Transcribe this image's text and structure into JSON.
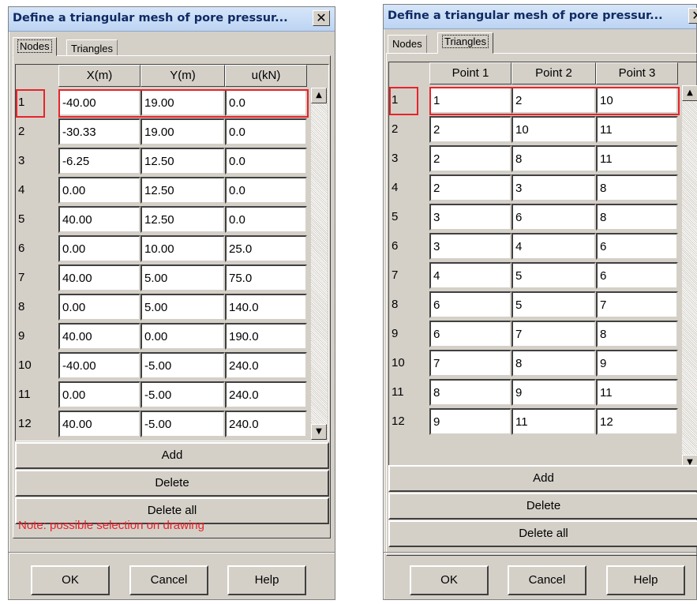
{
  "left_dialog": {
    "title": "Define a triangular mesh of pore pressur...",
    "close": "✕",
    "tabs": [
      "Nodes",
      "Triangles"
    ],
    "active_tab": "Nodes",
    "columns": [
      "X(m)",
      "Y(m)",
      "u(kN)"
    ],
    "rows": [
      {
        "id": "1",
        "cells": [
          "-40.00",
          "19.00",
          "0.0"
        ]
      },
      {
        "id": "2",
        "cells": [
          "-30.33",
          "19.00",
          "0.0"
        ]
      },
      {
        "id": "3",
        "cells": [
          "-6.25",
          "12.50",
          "0.0"
        ]
      },
      {
        "id": "4",
        "cells": [
          "0.00",
          "12.50",
          "0.0"
        ]
      },
      {
        "id": "5",
        "cells": [
          "40.00",
          "12.50",
          "0.0"
        ]
      },
      {
        "id": "6",
        "cells": [
          "0.00",
          "10.00",
          "25.0"
        ]
      },
      {
        "id": "7",
        "cells": [
          "40.00",
          "5.00",
          "75.0"
        ]
      },
      {
        "id": "8",
        "cells": [
          "0.00",
          "5.00",
          "140.0"
        ]
      },
      {
        "id": "9",
        "cells": [
          "40.00",
          "0.00",
          "190.0"
        ]
      },
      {
        "id": "10",
        "cells": [
          "-40.00",
          "-5.00",
          "240.0"
        ]
      },
      {
        "id": "11",
        "cells": [
          "0.00",
          "-5.00",
          "240.0"
        ]
      },
      {
        "id": "12",
        "cells": [
          "40.00",
          "-5.00",
          "240.0"
        ]
      }
    ],
    "buttons": {
      "add": "Add",
      "delete": "Delete",
      "delete_all": "Delete all"
    },
    "note": "Note: possible selection on drawing",
    "footer": {
      "ok": "OK",
      "cancel": "Cancel",
      "help": "Help"
    }
  },
  "right_dialog": {
    "title": "Define a triangular mesh of pore pressur...",
    "close": "✕",
    "tabs": [
      "Nodes",
      "Triangles"
    ],
    "active_tab": "Triangles",
    "columns": [
      "Point 1",
      "Point 2",
      "Point 3"
    ],
    "rows": [
      {
        "id": "1",
        "cells": [
          "1",
          "2",
          "10"
        ]
      },
      {
        "id": "2",
        "cells": [
          "2",
          "10",
          "11"
        ]
      },
      {
        "id": "3",
        "cells": [
          "2",
          "8",
          "11"
        ]
      },
      {
        "id": "4",
        "cells": [
          "2",
          "3",
          "8"
        ]
      },
      {
        "id": "5",
        "cells": [
          "3",
          "6",
          "8"
        ]
      },
      {
        "id": "6",
        "cells": [
          "3",
          "4",
          "6"
        ]
      },
      {
        "id": "7",
        "cells": [
          "4",
          "5",
          "6"
        ]
      },
      {
        "id": "8",
        "cells": [
          "6",
          "5",
          "7"
        ]
      },
      {
        "id": "9",
        "cells": [
          "6",
          "7",
          "8"
        ]
      },
      {
        "id": "10",
        "cells": [
          "7",
          "8",
          "9"
        ]
      },
      {
        "id": "11",
        "cells": [
          "8",
          "9",
          "11"
        ]
      },
      {
        "id": "12",
        "cells": [
          "9",
          "11",
          "12"
        ]
      }
    ],
    "buttons": {
      "add": "Add",
      "delete": "Delete",
      "delete_all": "Delete all"
    },
    "footer": {
      "ok": "OK",
      "cancel": "Cancel",
      "help": "Help"
    }
  },
  "icons": {
    "scroll_up": "▲",
    "scroll_down": "▼"
  },
  "colors": {
    "selection": "#e8232a",
    "note": "#e8232a",
    "titlebar": "#bcd4f3",
    "dialog": "#d4d0c8"
  }
}
